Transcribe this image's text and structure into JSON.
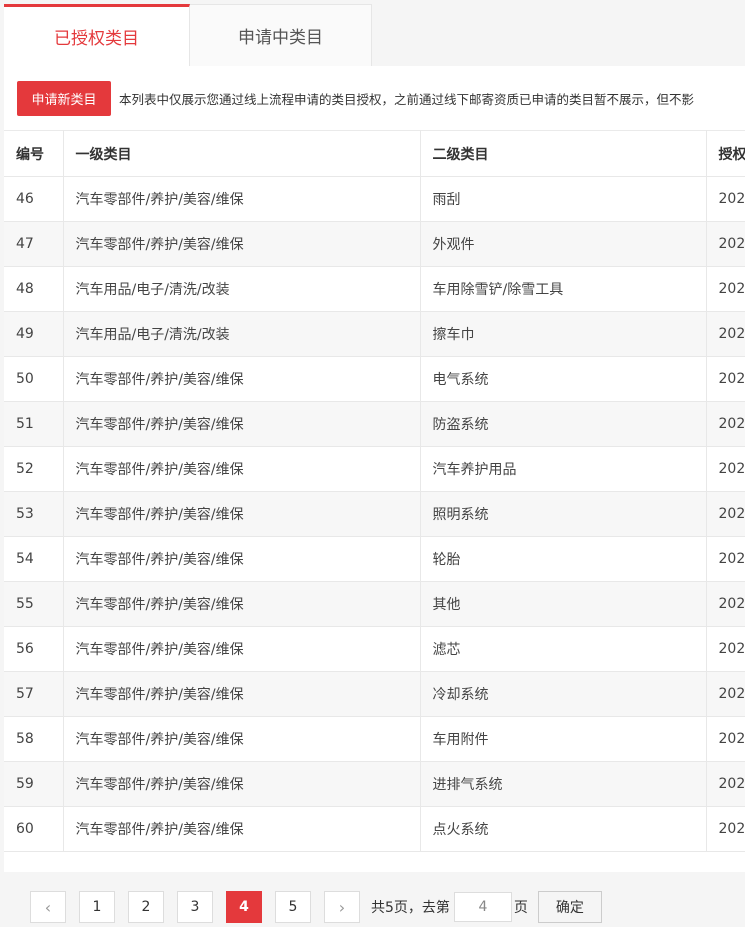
{
  "tabs": [
    {
      "label": "已授权类目",
      "active": true
    },
    {
      "label": "申请中类目",
      "active": false
    }
  ],
  "toolbar": {
    "apply_label": "申请新类目",
    "notice": "本列表中仅展示您通过线上流程申请的类目授权，之前通过线下邮寄资质已申请的类目暂不展示，但不影"
  },
  "table": {
    "headers": [
      "编号",
      "一级类目",
      "二级类目",
      "授权"
    ],
    "rows": [
      [
        "46",
        "汽车零部件/养护/美容/维保",
        "雨刮",
        "202"
      ],
      [
        "47",
        "汽车零部件/养护/美容/维保",
        "外观件",
        "202"
      ],
      [
        "48",
        "汽车用品/电子/清洗/改装",
        "车用除雪铲/除雪工具",
        "202"
      ],
      [
        "49",
        "汽车用品/电子/清洗/改装",
        "擦车巾",
        "202"
      ],
      [
        "50",
        "汽车零部件/养护/美容/维保",
        "电气系统",
        "202"
      ],
      [
        "51",
        "汽车零部件/养护/美容/维保",
        "防盗系统",
        "202"
      ],
      [
        "52",
        "汽车零部件/养护/美容/维保",
        "汽车养护用品",
        "202"
      ],
      [
        "53",
        "汽车零部件/养护/美容/维保",
        "照明系统",
        "202"
      ],
      [
        "54",
        "汽车零部件/养护/美容/维保",
        "轮胎",
        "202"
      ],
      [
        "55",
        "汽车零部件/养护/美容/维保",
        "其他",
        "202"
      ],
      [
        "56",
        "汽车零部件/养护/美容/维保",
        "滤芯",
        "202"
      ],
      [
        "57",
        "汽车零部件/养护/美容/维保",
        "冷却系统",
        "202"
      ],
      [
        "58",
        "汽车零部件/养护/美容/维保",
        "车用附件",
        "202"
      ],
      [
        "59",
        "汽车零部件/养护/美容/维保",
        "进排气系统",
        "202"
      ],
      [
        "60",
        "汽车零部件/养护/美容/维保",
        "点火系统",
        "202"
      ]
    ]
  },
  "pagination": {
    "prev": "‹",
    "next": "›",
    "pages": [
      "1",
      "2",
      "3",
      "4",
      "5"
    ],
    "current": 4,
    "total_text": "共5页，去第",
    "input_value": "4",
    "page_unit": "页",
    "confirm_label": "确定"
  },
  "colors": {
    "accent": "#e4393c"
  }
}
